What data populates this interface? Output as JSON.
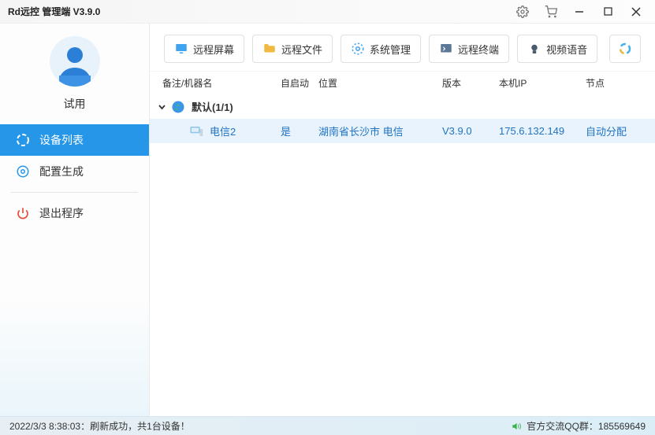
{
  "titlebar": {
    "title": "Rd远控 管理端 V3.9.0"
  },
  "sidebar": {
    "trial": "试用",
    "items": [
      {
        "label": "设备列表"
      },
      {
        "label": "配置生成"
      },
      {
        "label": "退出程序"
      }
    ]
  },
  "toolbar": {
    "buttons": [
      {
        "label": "远程屏幕"
      },
      {
        "label": "远程文件"
      },
      {
        "label": "系统管理"
      },
      {
        "label": "远程终端"
      },
      {
        "label": "视频语音"
      }
    ]
  },
  "table": {
    "headers": {
      "name": "备注/机器名",
      "autostart": "自启动",
      "location": "位置",
      "version": "版本",
      "ip": "本机IP",
      "node": "节点"
    },
    "group": {
      "label": "默认(1/1)"
    },
    "rows": [
      {
        "name": "电信2",
        "autostart": "是",
        "location": "湖南省长沙市 电信",
        "version": "V3.9.0",
        "ip": "175.6.132.149",
        "node": "自动分配"
      }
    ]
  },
  "statusbar": {
    "left": "2022/3/3 8:38:03：刷新成功，共1台设备！",
    "right": "官方交流QQ群：185569649"
  }
}
